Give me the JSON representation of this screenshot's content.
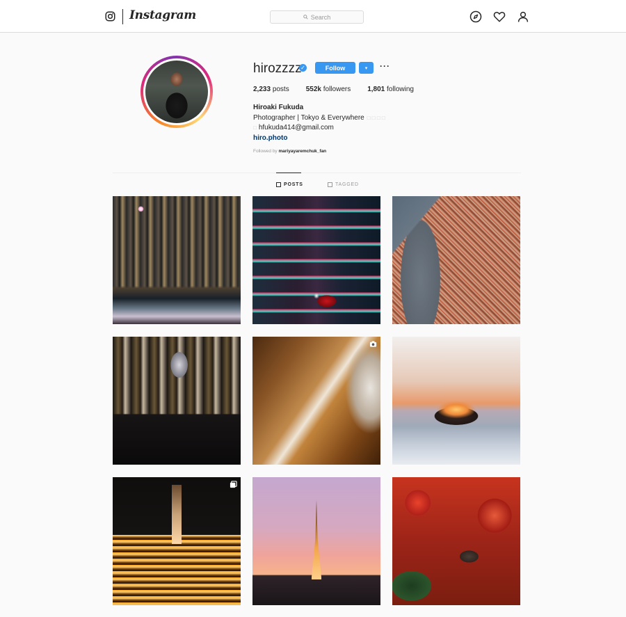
{
  "header": {
    "wordmark": "Instagram",
    "search_placeholder": "Search",
    "icons": [
      "instagram-camera-icon",
      "compass-icon",
      "heart-icon",
      "profile-icon"
    ]
  },
  "profile": {
    "username": "hirozzzz",
    "verified": true,
    "follow_label": "Follow",
    "dropdown_label": "▾",
    "more_label": "···",
    "stats": {
      "posts_count": "2,233",
      "posts_label": "posts",
      "followers_count": "552k",
      "followers_label": "followers",
      "following_count": "1,801",
      "following_label": "following"
    },
    "full_name": "Hiroaki Fukuda",
    "bio": "Photographer | Tokyo & Everywhere",
    "email": "hfukuda414@gmail.com",
    "website": "hiro.photo",
    "followed_by_label": "Followed by",
    "followed_by_user": "mariyayaremchuk_fan"
  },
  "tabs": [
    {
      "label": "POSTS",
      "active": true
    },
    {
      "label": "TAGGED",
      "active": false
    }
  ],
  "colors": {
    "accent": "#3897f0",
    "link": "#003569",
    "border": "#dbdbdb",
    "background": "#fafafa"
  }
}
